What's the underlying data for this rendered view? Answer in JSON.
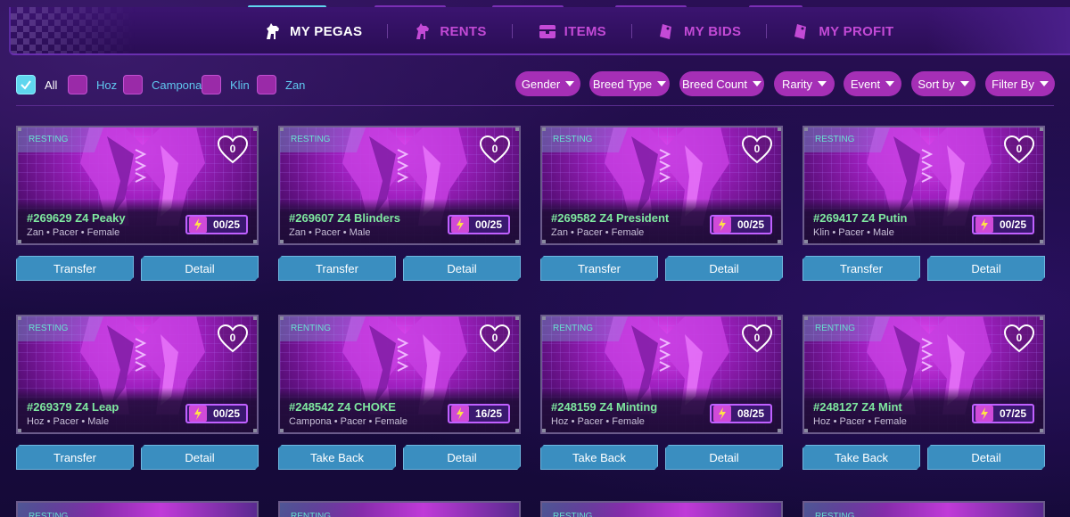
{
  "nav": {
    "tabs": [
      {
        "label": "MY PEGAS",
        "icon": "horse-icon",
        "active": true
      },
      {
        "label": "RENTS",
        "icon": "horse-icon",
        "active": false
      },
      {
        "label": "ITEMS",
        "icon": "chest-icon",
        "active": false
      },
      {
        "label": "MY BIDS",
        "icon": "tag-icon",
        "active": false
      },
      {
        "label": "MY PROFIT",
        "icon": "tag-icon",
        "active": false
      }
    ]
  },
  "filters": {
    "checkboxes": [
      {
        "label": "All",
        "checked": true
      },
      {
        "label": "Hoz",
        "checked": false
      },
      {
        "label": "Campona",
        "checked": false
      },
      {
        "label": "Klin",
        "checked": false
      },
      {
        "label": "Zan",
        "checked": false
      }
    ],
    "dropdowns": [
      "Gender",
      "Breed Type",
      "Breed Count",
      "Rarity",
      "Event",
      "Sort by",
      "Filter By"
    ]
  },
  "cards": [
    {
      "status": "RESTING",
      "likes": "0",
      "name": "#269629 Z4 Peaky",
      "meta": "Zan • Pacer • Female",
      "energy": "00/25",
      "left_button": "Transfer",
      "right_button": "Detail"
    },
    {
      "status": "RESTING",
      "likes": "0",
      "name": "#269607 Z4 Blinders",
      "meta": "Zan • Pacer • Male",
      "energy": "00/25",
      "left_button": "Transfer",
      "right_button": "Detail"
    },
    {
      "status": "RESTING",
      "likes": "0",
      "name": "#269582 Z4 President",
      "meta": "Zan • Pacer • Female",
      "energy": "00/25",
      "left_button": "Transfer",
      "right_button": "Detail"
    },
    {
      "status": "RESTING",
      "likes": "0",
      "name": "#269417 Z4 Putin",
      "meta": "Klin • Pacer • Male",
      "energy": "00/25",
      "left_button": "Transfer",
      "right_button": "Detail"
    },
    {
      "status": "RESTING",
      "likes": "0",
      "name": "#269379 Z4 Leap",
      "meta": "Hoz • Pacer • Male",
      "energy": "00/25",
      "left_button": "Transfer",
      "right_button": "Detail"
    },
    {
      "status": "RENTING",
      "likes": "0",
      "name": "#248542 Z4 CHOKE",
      "meta": "Campona • Pacer • Female",
      "energy": "16/25",
      "left_button": "Take Back",
      "right_button": "Detail"
    },
    {
      "status": "RENTING",
      "likes": "0",
      "name": "#248159 Z4 Minting",
      "meta": "Hoz • Pacer • Female",
      "energy": "08/25",
      "left_button": "Take Back",
      "right_button": "Detail"
    },
    {
      "status": "RENTING",
      "likes": "0",
      "name": "#248127 Z4 Mint",
      "meta": "Hoz • Pacer • Female",
      "energy": "07/25",
      "left_button": "Take Back",
      "right_button": "Detail"
    }
  ],
  "partial_cards": [
    {
      "status": "RESTING"
    },
    {
      "status": "RENTING"
    },
    {
      "status": "RESTING"
    },
    {
      "status": "RESTING"
    }
  ],
  "colors": {
    "accent_magenta": "#a52fb6",
    "button_blue": "#3a8ec0",
    "name_green": "#7fe8a0",
    "status_teal": "#68e0d0"
  }
}
